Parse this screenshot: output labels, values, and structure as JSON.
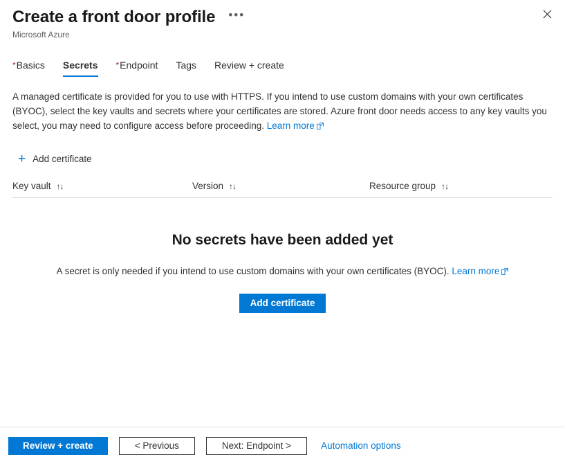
{
  "header": {
    "title": "Create a front door profile",
    "subtitle": "Microsoft Azure",
    "ellipsis_label": "•••",
    "close_label": "Close"
  },
  "tabs": [
    {
      "label": "Basics",
      "required": true,
      "active": false
    },
    {
      "label": "Secrets",
      "required": false,
      "active": true
    },
    {
      "label": "Endpoint",
      "required": true,
      "active": false
    },
    {
      "label": "Tags",
      "required": false,
      "active": false
    },
    {
      "label": "Review + create",
      "required": false,
      "active": false
    }
  ],
  "description": {
    "text": "A managed certificate is provided for you to use with HTTPS. If you intend to use custom domains with your own certificates (BYOC), select the key vaults and secrets where your certificates are stored. Azure front door needs access to any key vaults you select, you may need to configure access before proceeding.",
    "link_label": "Learn more"
  },
  "command_bar": {
    "add_certificate_label": "Add certificate",
    "plus_icon": "plus-icon"
  },
  "grid": {
    "columns": [
      {
        "label": "Key vault",
        "sort": "↑↓"
      },
      {
        "label": "Version",
        "sort": "↑↓"
      },
      {
        "label": "Resource group",
        "sort": "↑↓"
      }
    ],
    "rows": []
  },
  "empty_state": {
    "title": "No secrets have been added yet",
    "subtitle": "A secret is only needed if you intend to use custom domains with your own certificates (BYOC).",
    "link_label": "Learn more",
    "button_label": "Add certificate"
  },
  "footer": {
    "review_create_label": "Review + create",
    "previous_label": "< Previous",
    "next_label": "Next: Endpoint >",
    "automation_label": "Automation options"
  },
  "colors": {
    "accent": "#0078d4",
    "required_star": "#a4262c",
    "text": "#323130",
    "border": "#d6d6d6"
  }
}
